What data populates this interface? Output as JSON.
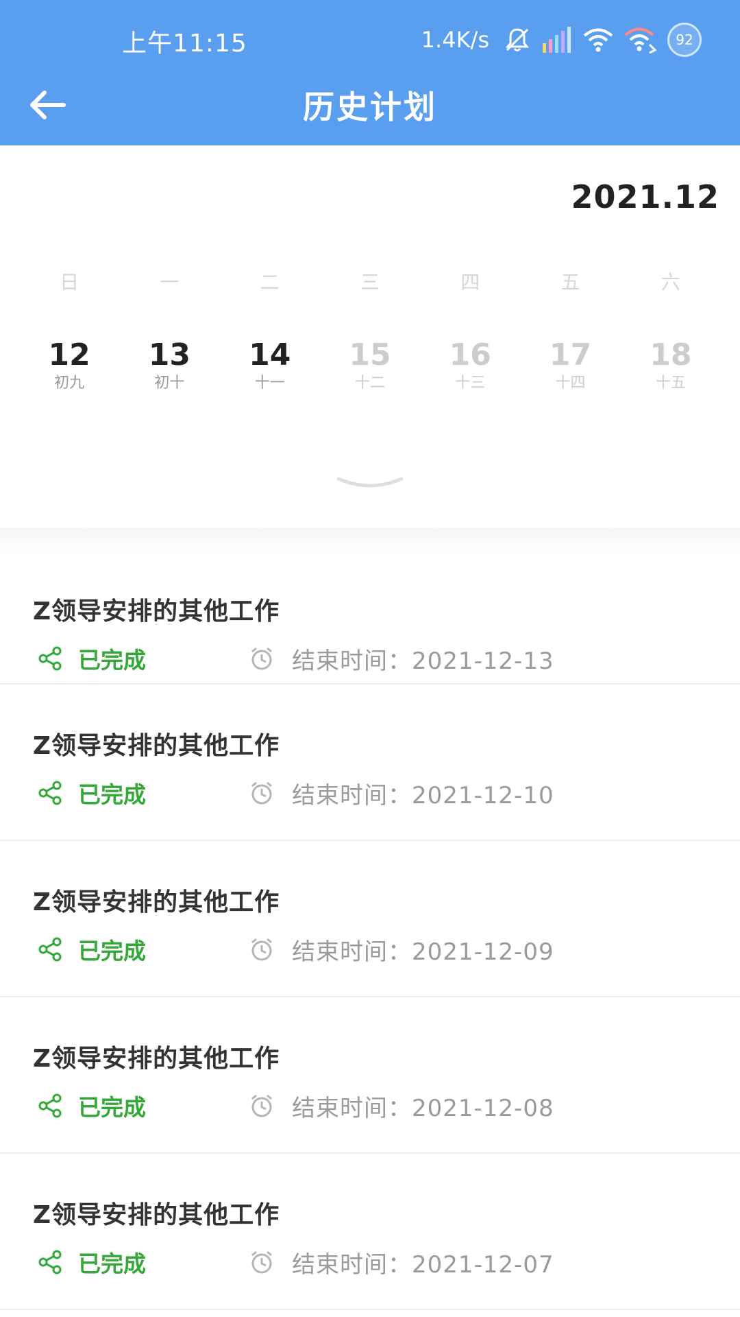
{
  "status_bar": {
    "time": "上午11:15",
    "net_speed": "1.4K/s",
    "battery": "92"
  },
  "header": {
    "title": "历史计划"
  },
  "calendar": {
    "month": "2021.12",
    "weekdays": [
      "日",
      "一",
      "二",
      "三",
      "四",
      "五",
      "六"
    ],
    "days": [
      {
        "num": "12",
        "lunar": "初九"
      },
      {
        "num": "13",
        "lunar": "初十"
      },
      {
        "num": "14",
        "lunar": "十一"
      },
      {
        "num": "15",
        "lunar": "十二"
      },
      {
        "num": "16",
        "lunar": "十三"
      },
      {
        "num": "17",
        "lunar": "十四"
      },
      {
        "num": "18",
        "lunar": "十五"
      }
    ]
  },
  "plans": [
    {
      "title": "Z领导安排的其他工作",
      "status": "已完成",
      "end_time": "结束时间：2021-12-13"
    },
    {
      "title": "Z领导安排的其他工作",
      "status": "已完成",
      "end_time": "结束时间：2021-12-10"
    },
    {
      "title": "Z领导安排的其他工作",
      "status": "已完成",
      "end_time": "结束时间：2021-12-09"
    },
    {
      "title": "Z领导安排的其他工作",
      "status": "已完成",
      "end_time": "结束时间：2021-12-08"
    },
    {
      "title": "Z领导安排的其他工作",
      "status": "已完成",
      "end_time": "结束时间：2021-12-07"
    }
  ],
  "colors": {
    "header_bg": "#5a9ef0",
    "status_done": "#35a83a",
    "meta_gray": "#9a9a9a"
  }
}
